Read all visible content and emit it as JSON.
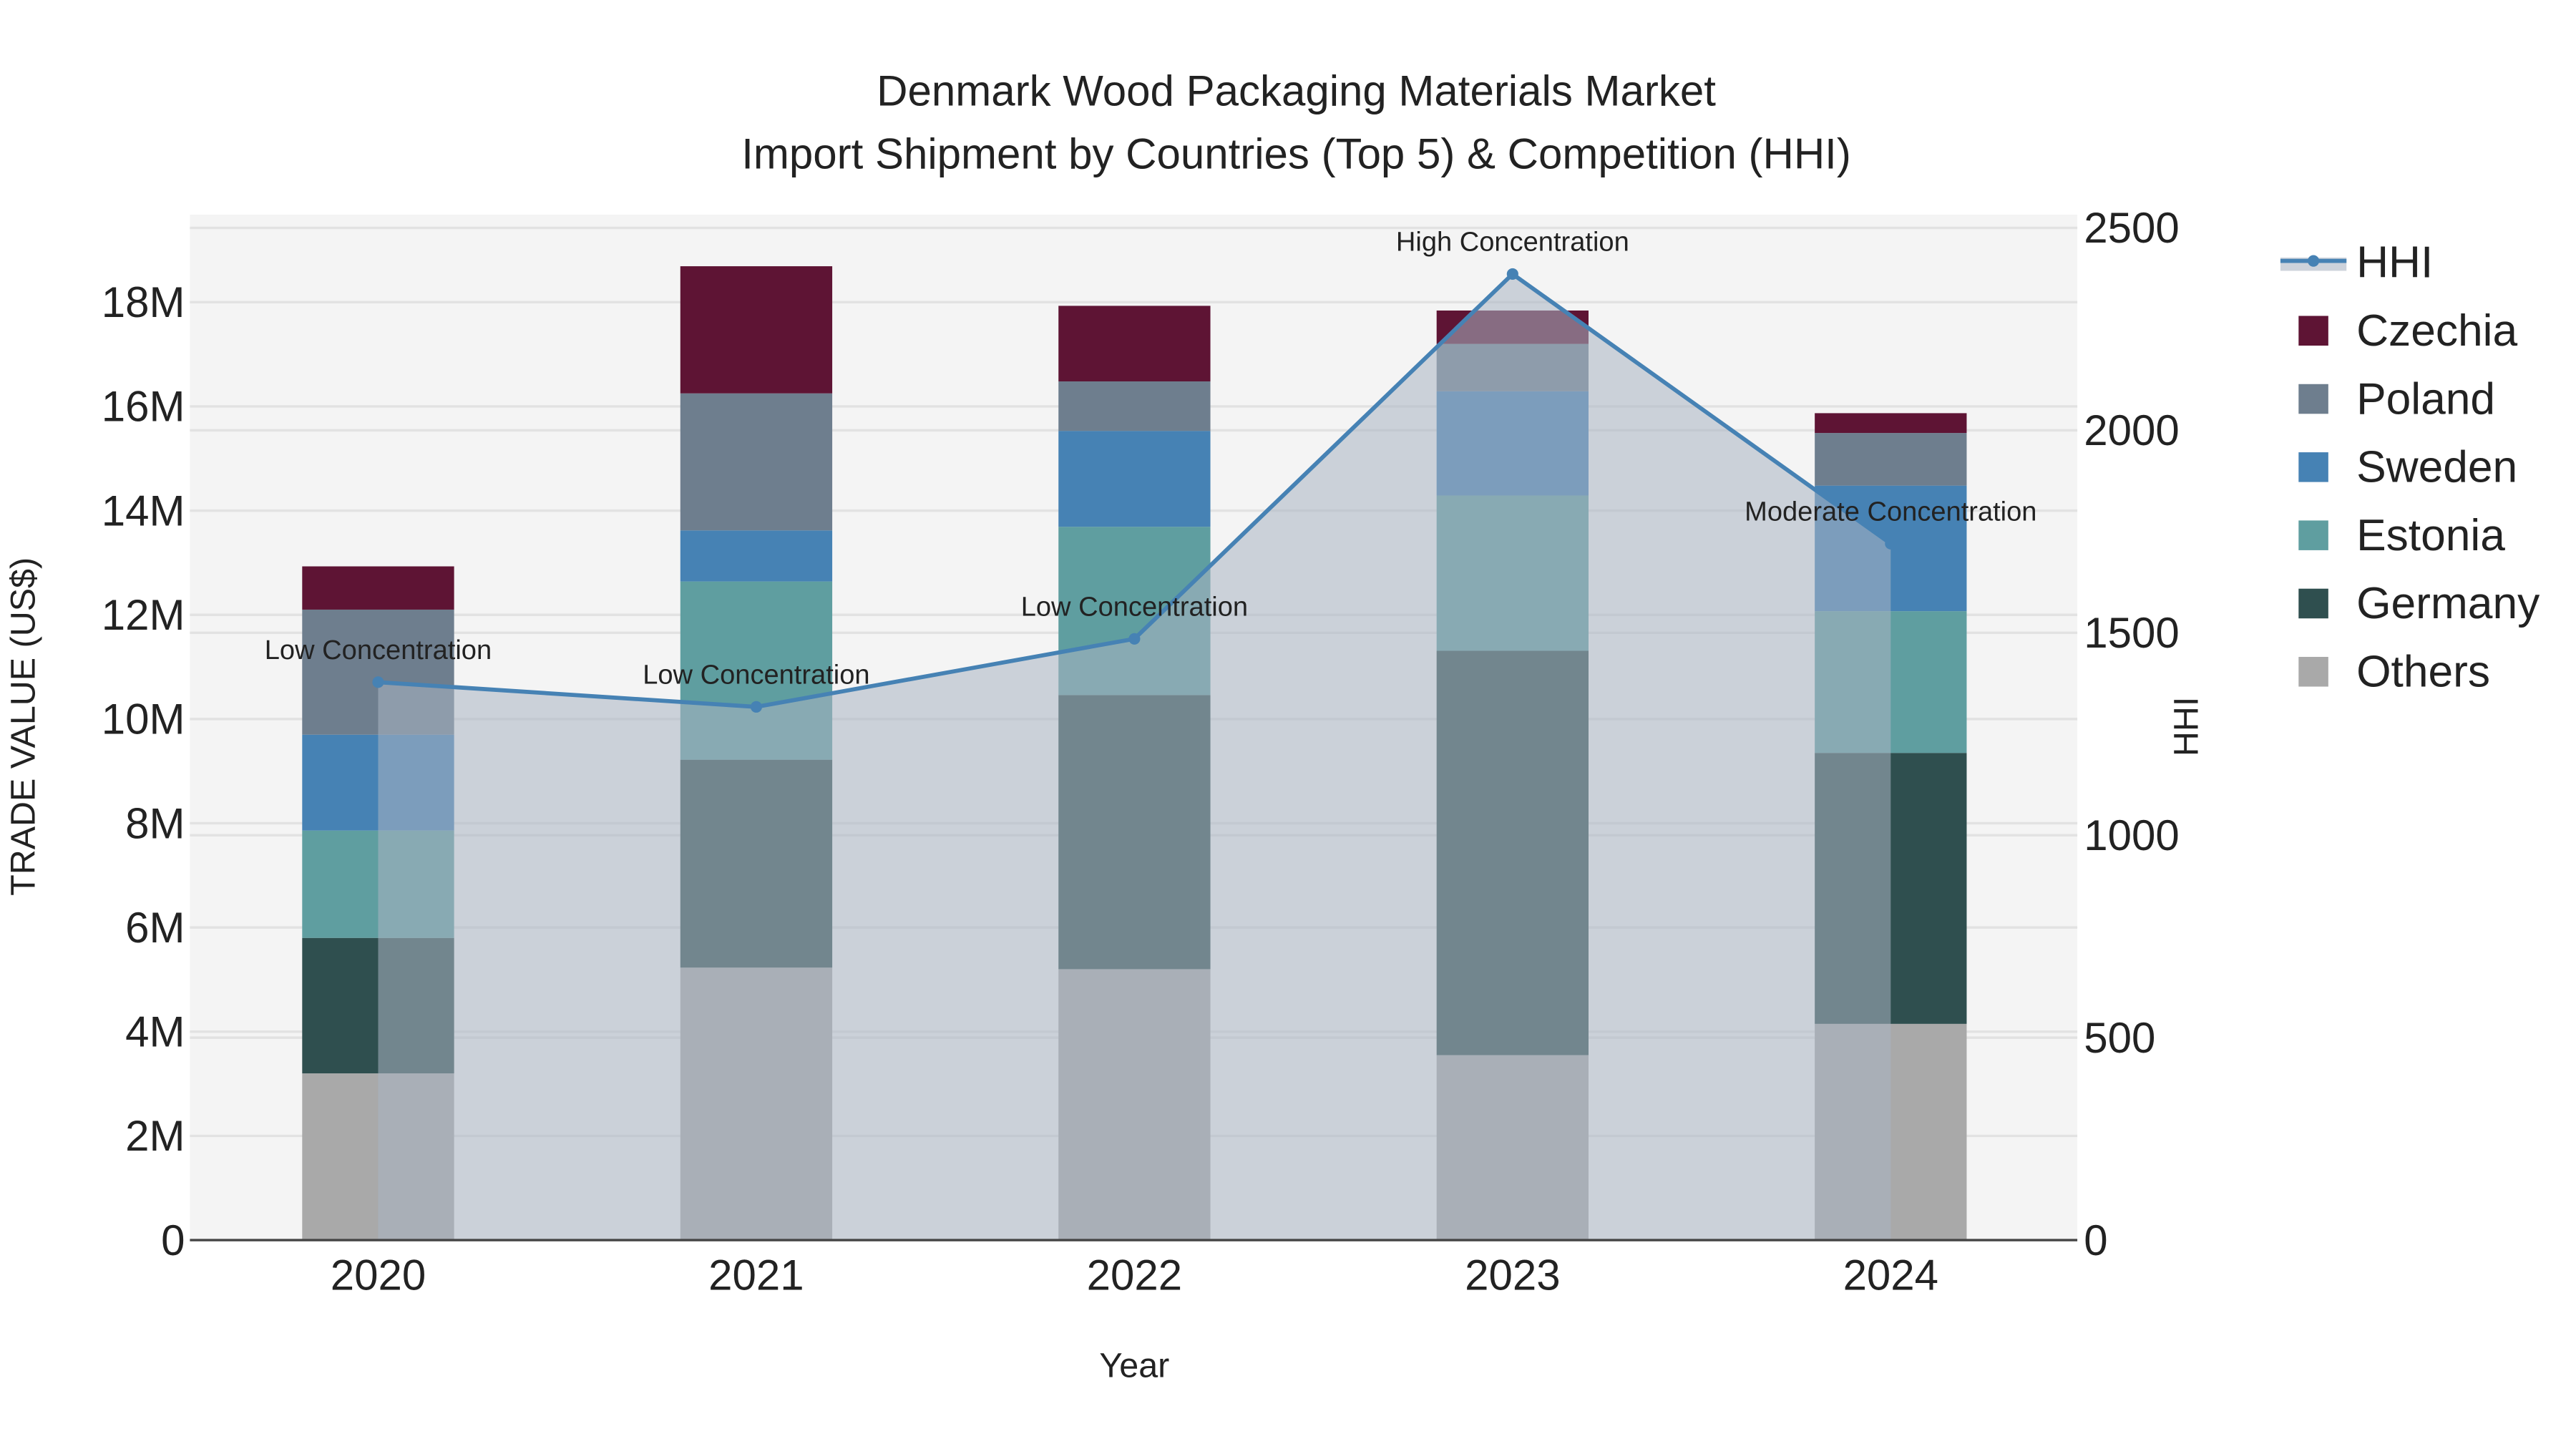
{
  "chart_data": {
    "type": "bar",
    "stacked": true,
    "title_line1": "Denmark Wood Packaging Materials Market",
    "title_line2": "Import Shipment by Countries (Top 5) & Competition (HHI)",
    "xlabel": "Year",
    "ylabel": "TRADE VALUE (US$)",
    "y2label": "HHI",
    "categories": [
      "2020",
      "2021",
      "2022",
      "2023",
      "2024"
    ],
    "ylim": [
      0,
      19.5
    ],
    "yticks": [
      0,
      2,
      4,
      6,
      8,
      10,
      12,
      14,
      16,
      18
    ],
    "ytick_labels": [
      "0",
      "2M",
      "4M",
      "6M",
      "8M",
      "10M",
      "12M",
      "14M",
      "16M",
      "18M"
    ],
    "y2lim": [
      0,
      2550
    ],
    "y2ticks": [
      0,
      500,
      1000,
      1500,
      2000,
      2500
    ],
    "y2tick_labels": [
      "0",
      "500",
      "1000",
      "1500",
      "2000",
      "2500"
    ],
    "unit": "million US$",
    "series": [
      {
        "name": "Others",
        "color": "#a9a9a9",
        "values": [
          3.2,
          5.23,
          5.2,
          3.55,
          4.15
        ]
      },
      {
        "name": "Germany",
        "color": "#2f4f4f",
        "values": [
          2.6,
          3.99,
          5.26,
          7.76,
          5.2
        ]
      },
      {
        "name": "Estonia",
        "color": "#5f9ea0",
        "values": [
          2.06,
          3.42,
          3.23,
          2.98,
          2.72
        ]
      },
      {
        "name": "Sweden",
        "color": "#4682b4",
        "values": [
          1.84,
          0.98,
          1.84,
          2.0,
          2.41
        ]
      },
      {
        "name": "Poland",
        "color": "#6e7e8e",
        "values": [
          2.4,
          2.63,
          0.95,
          0.91,
          1.01
        ]
      },
      {
        "name": "Czechia",
        "color": "#5e1434",
        "values": [
          0.83,
          2.44,
          1.45,
          0.64,
          0.38
        ]
      }
    ],
    "hhi": {
      "name": "HHI",
      "color": "#4682b4",
      "values": [
        1378,
        1317,
        1485,
        2386,
        1720
      ],
      "annotations": [
        "Low Concentration",
        "Low Concentration",
        "Low Concentration",
        "High Concentration",
        "Moderate Concentration"
      ]
    },
    "legend_order": [
      "HHI",
      "Czechia",
      "Poland",
      "Sweden",
      "Estonia",
      "Germany",
      "Others"
    ],
    "legend_placement": "right",
    "grid": true
  }
}
